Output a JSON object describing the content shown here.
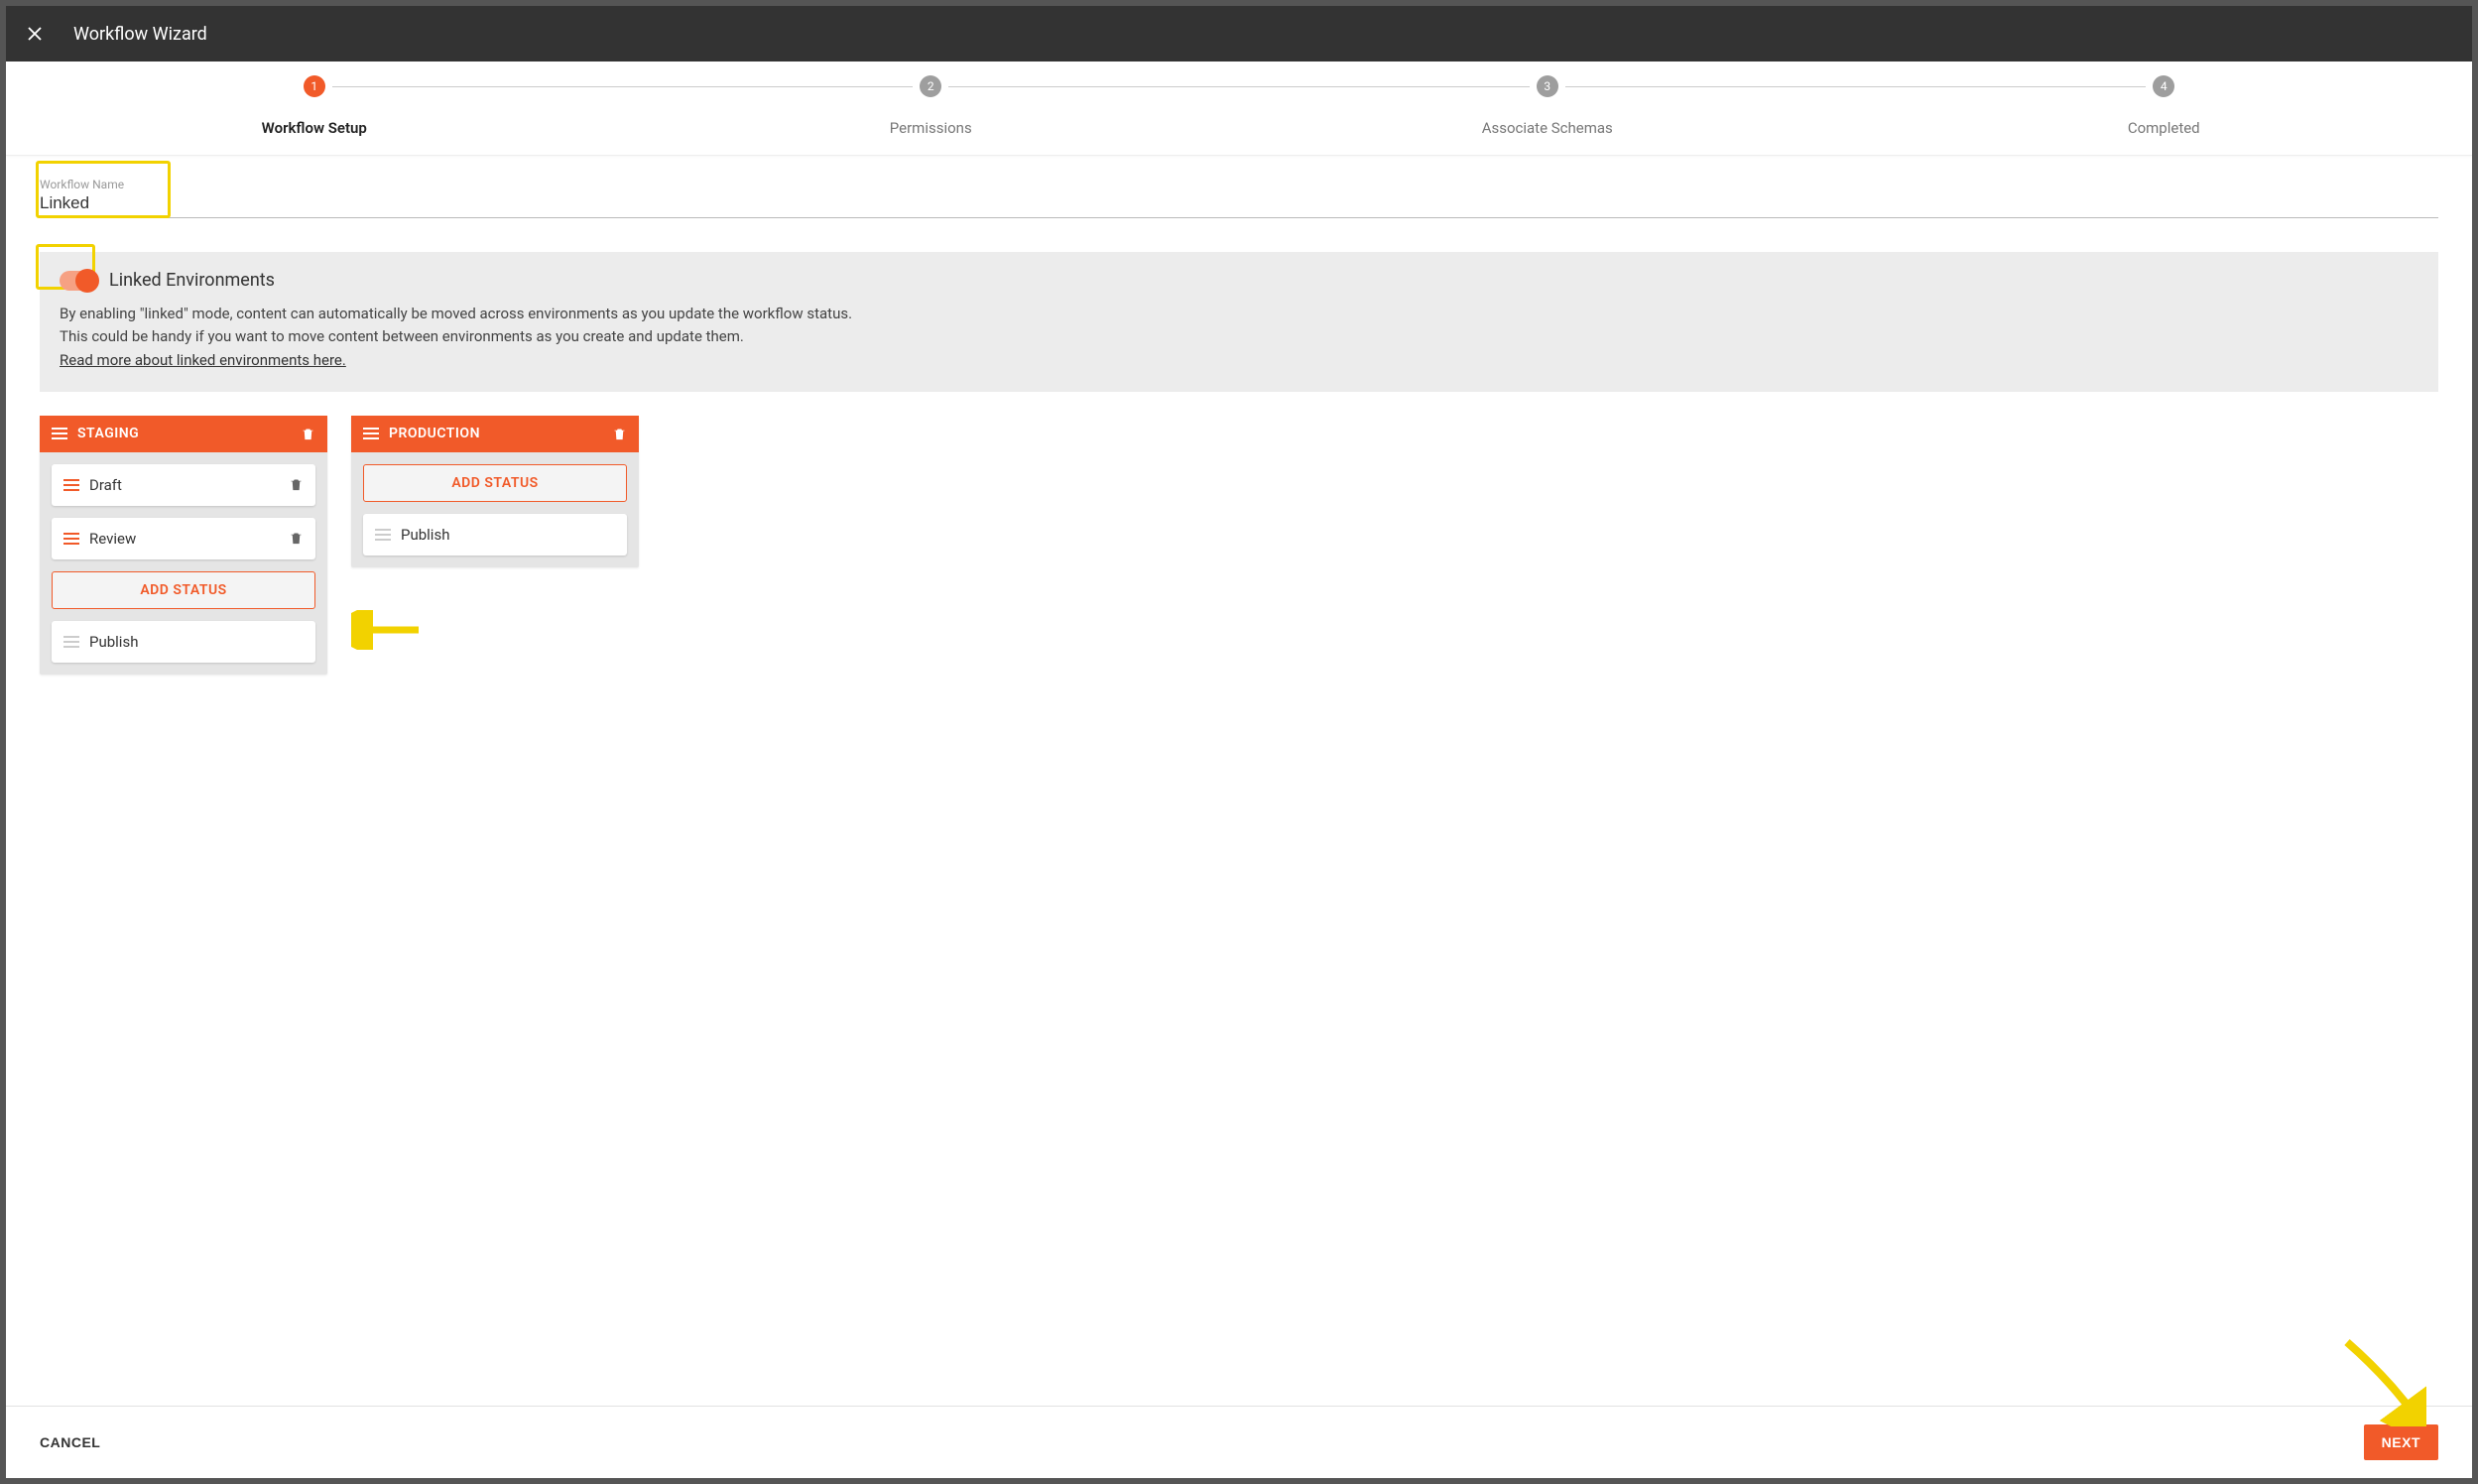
{
  "dialog": {
    "title": "Workflow Wizard"
  },
  "stepper": {
    "steps": [
      {
        "num": "1",
        "label": "Workflow Setup",
        "active": true
      },
      {
        "num": "2",
        "label": "Permissions",
        "active": false
      },
      {
        "num": "3",
        "label": "Associate Schemas",
        "active": false
      },
      {
        "num": "4",
        "label": "Completed",
        "active": false
      }
    ]
  },
  "nameField": {
    "label": "Workflow Name",
    "value": "Linked"
  },
  "linkedPanel": {
    "toggleOn": true,
    "title": "Linked Environments",
    "desc1": "By enabling \"linked\" mode, content can automatically be moved across environments as you update the workflow status.",
    "desc2": "This could be handy if you want to move content between environments as you create and update them.",
    "readMore": "Read more about linked environments here."
  },
  "columns": [
    {
      "title": "STAGING",
      "deletable": true,
      "statuses": [
        {
          "label": "Draft",
          "iconColor": "orange",
          "deletable": true
        },
        {
          "label": "Review",
          "iconColor": "orange",
          "deletable": true
        }
      ],
      "addLabel": "ADD STATUS",
      "trailing": [
        {
          "label": "Publish",
          "iconColor": "light",
          "deletable": false
        }
      ]
    },
    {
      "title": "PRODUCTION",
      "deletable": true,
      "addLabel": "ADD STATUS",
      "statuses": [],
      "trailing": [
        {
          "label": "Publish",
          "iconColor": "light",
          "deletable": false
        }
      ],
      "addFirst": true
    }
  ],
  "footer": {
    "cancel": "CANCEL",
    "next": "NEXT"
  }
}
